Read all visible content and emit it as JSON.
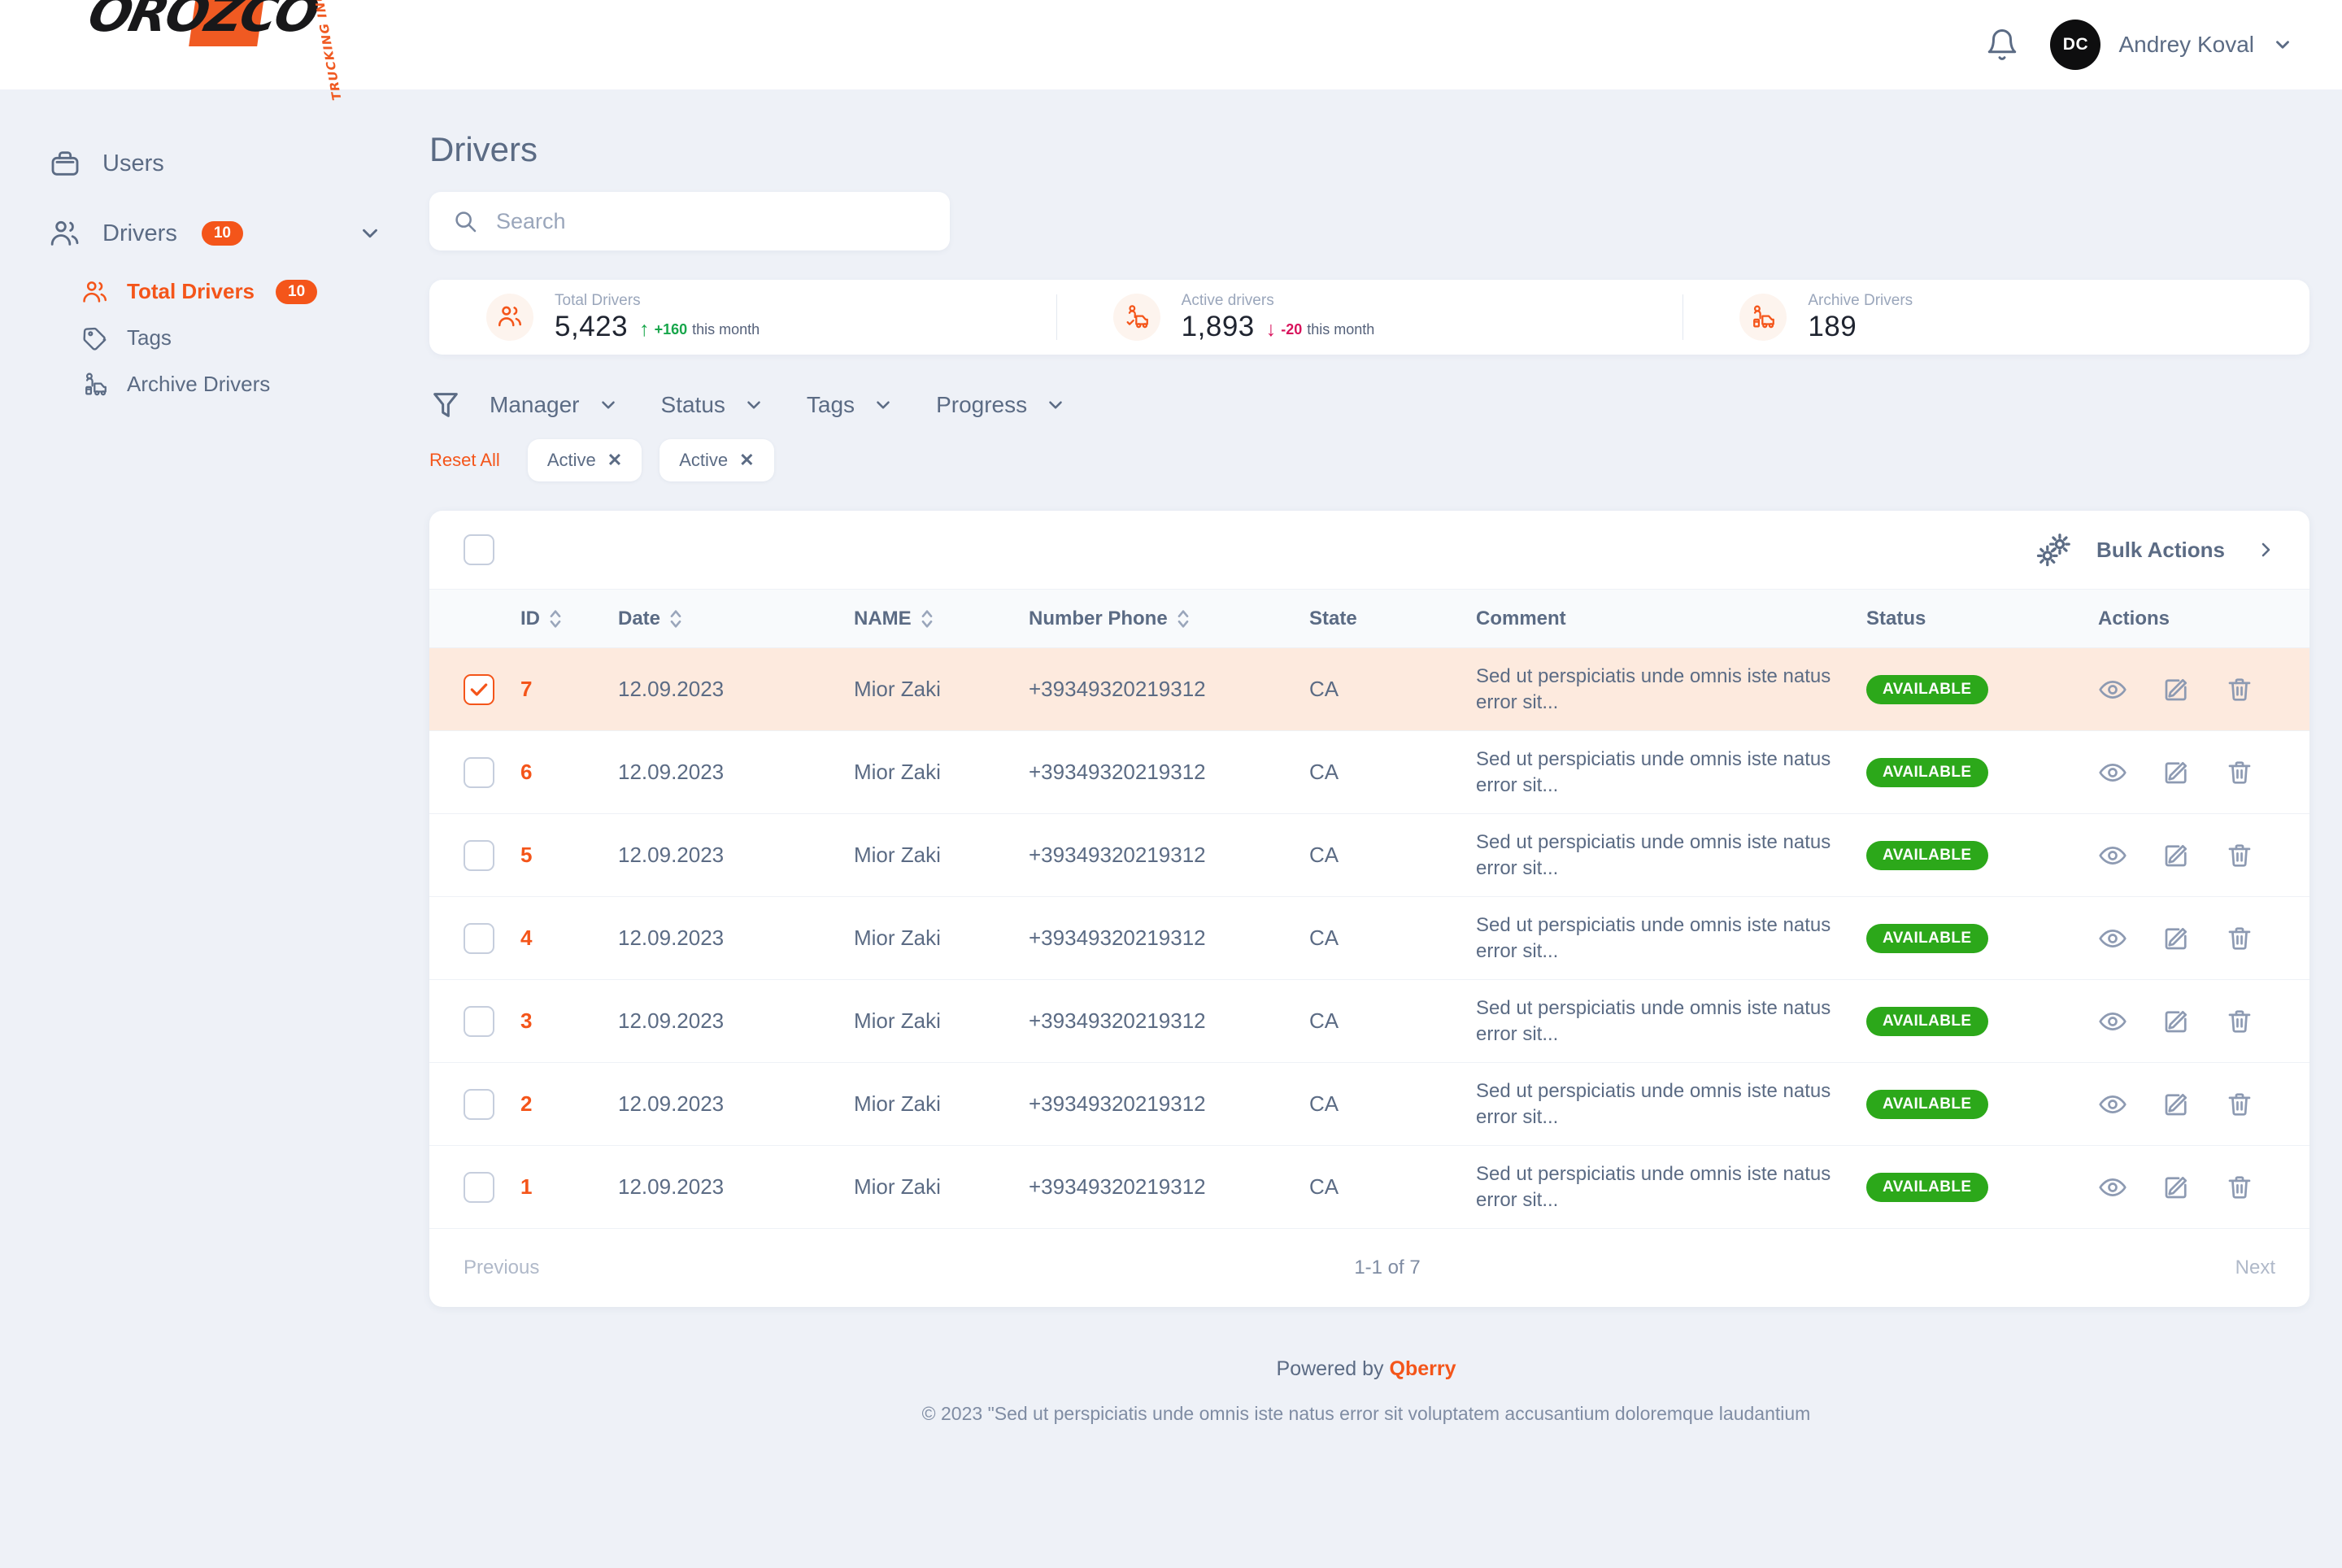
{
  "brand": {
    "logo_part1": "ORO",
    "logo_z": "Z",
    "logo_part2": "CO",
    "logo_sub": "TRUCKING INC",
    "accent": "#f4551a"
  },
  "topbar": {
    "notification_icon": "bell-icon",
    "avatar_initials": "DC",
    "user_name": "Andrey Koval",
    "user_chevron_icon": "chevron-down-icon"
  },
  "sidebar": {
    "items": [
      {
        "label": "Users",
        "icon": "briefcase-icon",
        "badge": "",
        "active": false
      },
      {
        "label": "Drivers",
        "icon": "users-icon",
        "badge": "10",
        "active": false
      }
    ],
    "subitems": [
      {
        "label": "Total Drivers",
        "icon": "users-icon",
        "badge": "10",
        "active": true
      },
      {
        "label": "Tags",
        "icon": "tag-icon",
        "badge": "",
        "active": false
      },
      {
        "label": "Archive Drivers",
        "icon": "archive-truck-icon",
        "badge": "",
        "active": false
      }
    ]
  },
  "main": {
    "page_title": "Drivers",
    "search": {
      "placeholder": "Search",
      "value": "",
      "icon": "search-icon"
    }
  },
  "stats": [
    {
      "label": "Total Drivers",
      "value": "5,423",
      "delta": "+160",
      "delta_suffix": "this month",
      "direction": "up",
      "icon": "users-icon"
    },
    {
      "label": "Active drivers",
      "value": "1,893",
      "delta": "-20",
      "delta_suffix": "this month",
      "direction": "down",
      "icon": "driver-truck-icon"
    },
    {
      "label": "Archive Drivers",
      "value": "189",
      "delta": "",
      "delta_suffix": "",
      "direction": "none",
      "icon": "archive-truck-icon"
    }
  ],
  "filters": {
    "funnel_icon": "funnel-icon",
    "dropdowns": [
      {
        "label": "Manager"
      },
      {
        "label": "Status"
      },
      {
        "label": "Tags"
      },
      {
        "label": "Progress"
      }
    ],
    "reset_label": "Reset All",
    "chips": [
      {
        "label": "Active",
        "remove_icon": "close-icon"
      },
      {
        "label": "Active",
        "remove_icon": "close-icon"
      }
    ]
  },
  "toolbar": {
    "select_all_checked": false,
    "bulk_actions_label": "Bulk Actions",
    "bulk_icon": "gears-icon",
    "expand_icon": "chevron-right-icon"
  },
  "table": {
    "columns": [
      {
        "key": "checkbox",
        "label": "",
        "sortable": false
      },
      {
        "key": "id",
        "label": "ID",
        "sortable": true
      },
      {
        "key": "date",
        "label": "Date",
        "sortable": true
      },
      {
        "key": "name",
        "label": "NAME",
        "sortable": true
      },
      {
        "key": "phone",
        "label": "Number Phone",
        "sortable": true
      },
      {
        "key": "state",
        "label": "State",
        "sortable": false
      },
      {
        "key": "comment",
        "label": "Comment",
        "sortable": false
      },
      {
        "key": "status",
        "label": "Status",
        "sortable": false
      },
      {
        "key": "actions",
        "label": "Actions",
        "sortable": false
      }
    ],
    "rows": [
      {
        "selected": true,
        "id": "7",
        "date": "12.09.2023",
        "name": "Mior Zaki",
        "phone": "+39349320219312",
        "state": "CA",
        "comment": "Sed ut perspiciatis unde omnis iste natus error sit...",
        "status": "AVAILABLE"
      },
      {
        "selected": false,
        "id": "6",
        "date": "12.09.2023",
        "name": "Mior Zaki",
        "phone": "+39349320219312",
        "state": "CA",
        "comment": "Sed ut perspiciatis unde omnis iste natus error sit...",
        "status": "AVAILABLE"
      },
      {
        "selected": false,
        "id": "5",
        "date": "12.09.2023",
        "name": "Mior Zaki",
        "phone": "+39349320219312",
        "state": "CA",
        "comment": "Sed ut perspiciatis unde omnis iste natus error sit...",
        "status": "AVAILABLE"
      },
      {
        "selected": false,
        "id": "4",
        "date": "12.09.2023",
        "name": "Mior Zaki",
        "phone": "+39349320219312",
        "state": "CA",
        "comment": "Sed ut perspiciatis unde omnis iste natus error sit...",
        "status": "AVAILABLE"
      },
      {
        "selected": false,
        "id": "3",
        "date": "12.09.2023",
        "name": "Mior Zaki",
        "phone": "+39349320219312",
        "state": "CA",
        "comment": "Sed ut perspiciatis unde omnis iste natus error sit...",
        "status": "AVAILABLE"
      },
      {
        "selected": false,
        "id": "2",
        "date": "12.09.2023",
        "name": "Mior Zaki",
        "phone": "+39349320219312",
        "state": "CA",
        "comment": "Sed ut perspiciatis unde omnis iste natus error sit...",
        "status": "AVAILABLE"
      },
      {
        "selected": false,
        "id": "1",
        "date": "12.09.2023",
        "name": "Mior Zaki",
        "phone": "+39349320219312",
        "state": "CA",
        "comment": "Sed ut perspiciatis unde omnis iste natus error sit...",
        "status": "AVAILABLE"
      }
    ],
    "row_action_icons": [
      "eye-icon",
      "edit-icon",
      "trash-icon"
    ],
    "status_color": "#2ca81a"
  },
  "pagination": {
    "previous_label": "Previous",
    "count_label": "1-1 of 7",
    "next_label": "Next"
  },
  "footer": {
    "powered_prefix": "Powered by",
    "powered_brand": "Qberry",
    "copyright": "© 2023 \"Sed ut perspiciatis unde omnis iste natus error sit voluptatem accusantium doloremque laudantium"
  }
}
